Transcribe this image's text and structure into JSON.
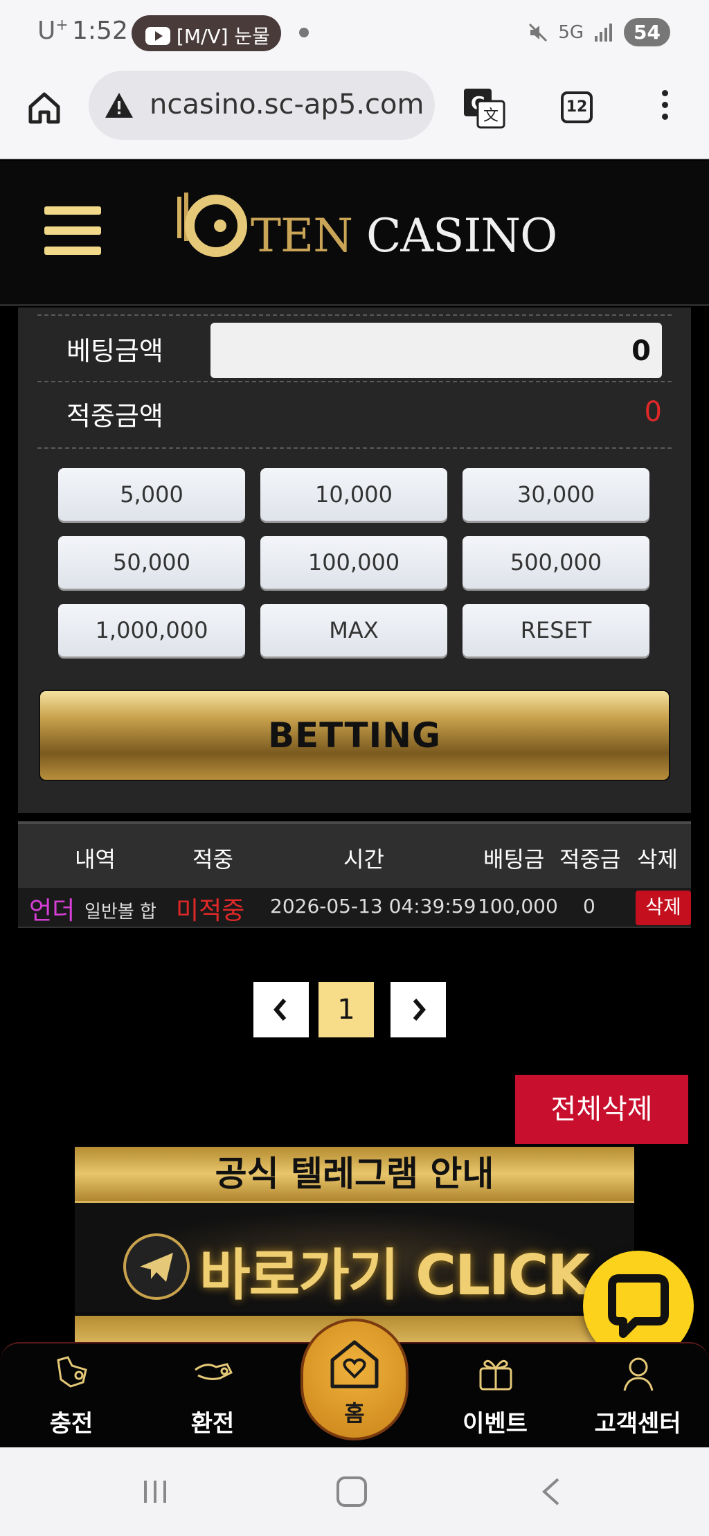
{
  "status_bar": {
    "carrier": "U",
    "carrier_sup": "+",
    "time": "1:52",
    "notification": "[M/V] 눈물",
    "network": "5G",
    "battery": "54"
  },
  "browser": {
    "url": "ncasino.sc-ap5.com",
    "tab_count": "12"
  },
  "site": {
    "logo_ten": "TEN",
    "logo_casino": "CASINO"
  },
  "bet_form": {
    "bet_amount_label": "베팅금액",
    "bet_amount_value": "0",
    "win_amount_label": "적중금액",
    "win_amount_value": "0",
    "amount_buttons": [
      "5,000",
      "10,000",
      "30,000",
      "50,000",
      "100,000",
      "500,000",
      "1,000,000",
      "MAX",
      "RESET"
    ],
    "betting_button": "BETTING"
  },
  "history": {
    "headers": [
      "내역",
      "적중",
      "시간",
      "배팅금",
      "적중금",
      "삭제"
    ],
    "rows": [
      {
        "pick": "언더",
        "game": "일반볼 합",
        "result": "미적중",
        "time": "2026-05-13 04:39:59",
        "bet": "100,000",
        "win": "0",
        "delete": "삭제"
      }
    ]
  },
  "pagination": {
    "current": "1"
  },
  "delete_all": "전체삭제",
  "banner": {
    "title": "공식 텔레그램 안내",
    "cta": "바로가기 CLICK"
  },
  "bottom_nav": {
    "items": [
      "충전",
      "환전",
      "홈",
      "이벤트",
      "고객센터"
    ]
  },
  "colors": {
    "gold": "#c9a24d",
    "red": "#c8102e",
    "pink": "#d83fd8",
    "chat_yellow": "#fcd21c"
  }
}
